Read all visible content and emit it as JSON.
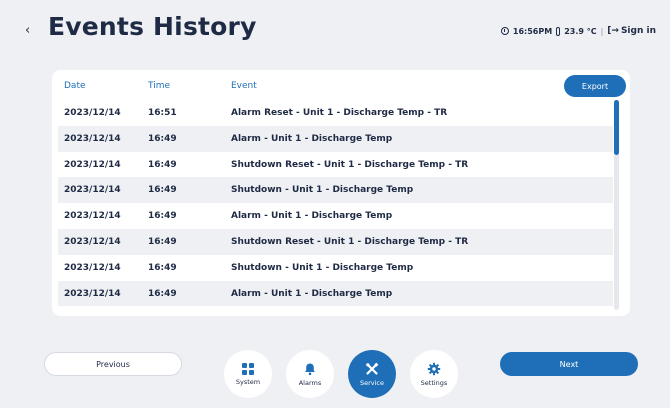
{
  "header": {
    "title": "Events History",
    "back_icon": "‹",
    "time": "16:56PM",
    "temperature": "23.9 °C",
    "sign_in": "Sign in"
  },
  "table": {
    "export_label": "Export",
    "columns": {
      "date": "Date",
      "time": "Time",
      "event": "Event"
    },
    "rows": [
      {
        "date": "2023/12/14",
        "time": "16:51",
        "event": "Alarm Reset - Unit 1 - Discharge Temp - TR"
      },
      {
        "date": "2023/12/14",
        "time": "16:49",
        "event": "Alarm - Unit 1 - Discharge Temp"
      },
      {
        "date": "2023/12/14",
        "time": "16:49",
        "event": "Shutdown Reset - Unit 1 - Discharge Temp - TR"
      },
      {
        "date": "2023/12/14",
        "time": "16:49",
        "event": "Shutdown - Unit 1 - Discharge Temp"
      },
      {
        "date": "2023/12/14",
        "time": "16:49",
        "event": "Alarm - Unit 1 - Discharge Temp"
      },
      {
        "date": "2023/12/14",
        "time": "16:49",
        "event": "Shutdown Reset - Unit 1 - Discharge Temp - TR"
      },
      {
        "date": "2023/12/14",
        "time": "16:49",
        "event": "Shutdown - Unit 1 - Discharge Temp"
      },
      {
        "date": "2023/12/14",
        "time": "16:49",
        "event": "Alarm - Unit 1 - Discharge Temp"
      }
    ]
  },
  "footer": {
    "previous_label": "Previous",
    "next_label": "Next",
    "nav": {
      "system": "System",
      "alarms": "Alarms",
      "service": "Service",
      "settings": "Settings"
    }
  },
  "colors": {
    "accent": "#1f6fb8",
    "text": "#1f2a44",
    "background": "#eef0f3"
  },
  "icons": {
    "back": "chevron-left-icon",
    "clock": "clock-icon",
    "thermometer": "thermometer-icon",
    "sign_in": "sign-in-icon",
    "system": "grid-icon",
    "alarms": "bell-icon",
    "service": "tools-icon",
    "settings": "gear-icon"
  }
}
